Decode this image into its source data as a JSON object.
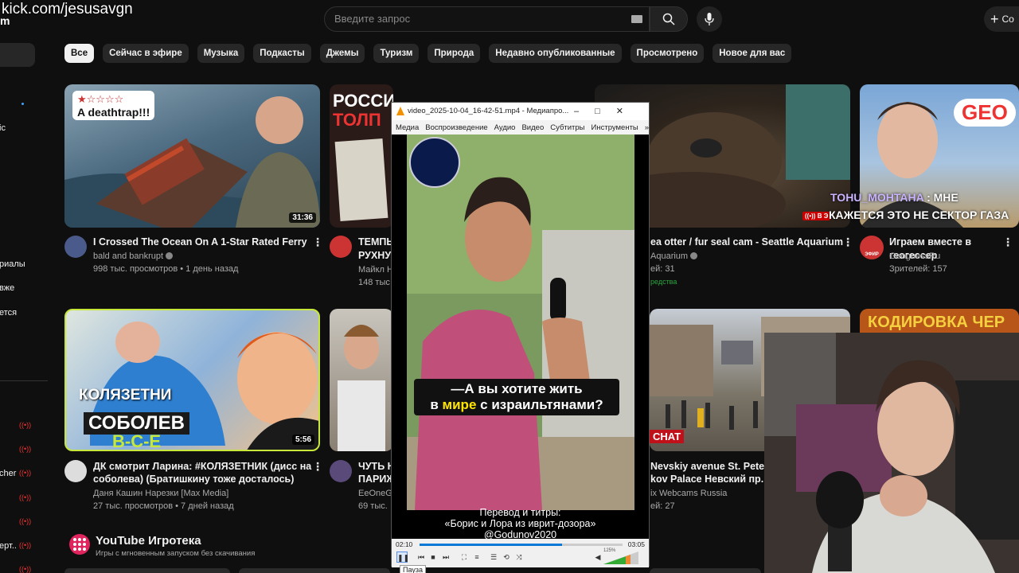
{
  "overlay": {
    "watermark": "kick.com/jesusavgn",
    "watermark_cut": "m"
  },
  "search": {
    "placeholder": "Введите запрос"
  },
  "header": {
    "create_label": "Со"
  },
  "sidebar": {
    "labels": [
      {
        "text": "ic",
        "top": 0
      },
      {
        "text": "риалы"
      },
      {
        "text": "вже"
      },
      {
        "text": "ется"
      },
      {
        "text": "cher"
      },
      {
        "text": "ерт.."
      }
    ]
  },
  "chips": [
    "Все",
    "Сейчас в эфире",
    "Музыка",
    "Подкасты",
    "Джемы",
    "Туризм",
    "Природа",
    "Недавно опубликованные",
    "Просмотрено",
    "Новое для вас"
  ],
  "videos": [
    {
      "title": "I Crossed The Ocean On A 1-Star Rated Ferry",
      "channel": "bald and bankrupt",
      "meta": "998 тыс. просмотров • 1 день назад",
      "duration": "31:36",
      "thumb_text": "A deathtrap!!!"
    },
    {
      "title": "ТЕМПЬ",
      "title2": "РУХНУ",
      "channel": "Майкл Н",
      "meta": "148 тыс",
      "thumb_text": "РОССИЯ ИДЁТ ВПЕРЁД",
      "thumb_text2": "ТОЛП"
    },
    {
      "title": "ea otter / fur seal cam - Seattle Aquarium",
      "channel": "Aquarium",
      "meta": "ей: 31",
      "live_badge": "редства"
    },
    {
      "title": "Играем вместе в геогессер",
      "channel": "GeoguessRu",
      "meta": "Зрителей: 157",
      "thumb_text": "GEO",
      "chat_name": "TOHU_MOHTAHA",
      "chat_msg": ": МНЕ",
      "chat_msg2": "КАЖЕТСЯ ЭТО НЕ СЕКТОР ГАЗА",
      "live_label": "В Э",
      "avatar_text": "ЭФИР"
    },
    {
      "title": "ДК смотрит Ларина: #КОЛЯЗЕТНИК (дисс на",
      "title2": "соболева) (Братишкину тоже досталось)",
      "channel": "Даня Кашин Нарезки [Max Media]",
      "meta": "27 тыс. просмотров • 7 дней назад",
      "duration": "5:56",
      "thumb_text": "КОЛЯЗЕТНИ",
      "thumb_text2": "СОБОЛЕВ",
      "thumb_text3": "В-С-Е"
    },
    {
      "title": "ЧУТЬ Н",
      "title2": "ПАРИЖ",
      "channel": "EeOneGu",
      "meta": "69 тыс."
    },
    {
      "title": "Nevskiy avenue St. Petersb",
      "title2": "kov Palace Невский пр. А",
      "channel": "ix Webcams Russia",
      "meta": "ей: 27",
      "thumb_text": "CHAT"
    },
    {
      "title": "",
      "thumb_text": "КОДИРОВКА ЧЕР"
    }
  ],
  "player": {
    "title": "video_2025-10-04_16-42-51.mp4 - Медиапро...",
    "menu": [
      "Медиа",
      "Воспроизведение",
      "Аудио",
      "Видео",
      "Субтитры",
      "Инструменты",
      "»"
    ],
    "caption_line1": "—А вы хотите жить",
    "caption_line2a": "в",
    "caption_line2b": "мире",
    "caption_line2c": "с израильтянами?",
    "credit1": "Перевод и титры:",
    "credit2": "«Борис и Лора из иврит-дозора»",
    "credit3": "@Godunov2020",
    "time_elapsed": "02:10",
    "time_total": "03:05",
    "progress": 0.7,
    "volume_label": "125%",
    "tooltip": "Пауза"
  },
  "shelf": {
    "title": "YouTube Игротека",
    "subtitle": "Игры с мгновенным запуском без скачивания"
  }
}
